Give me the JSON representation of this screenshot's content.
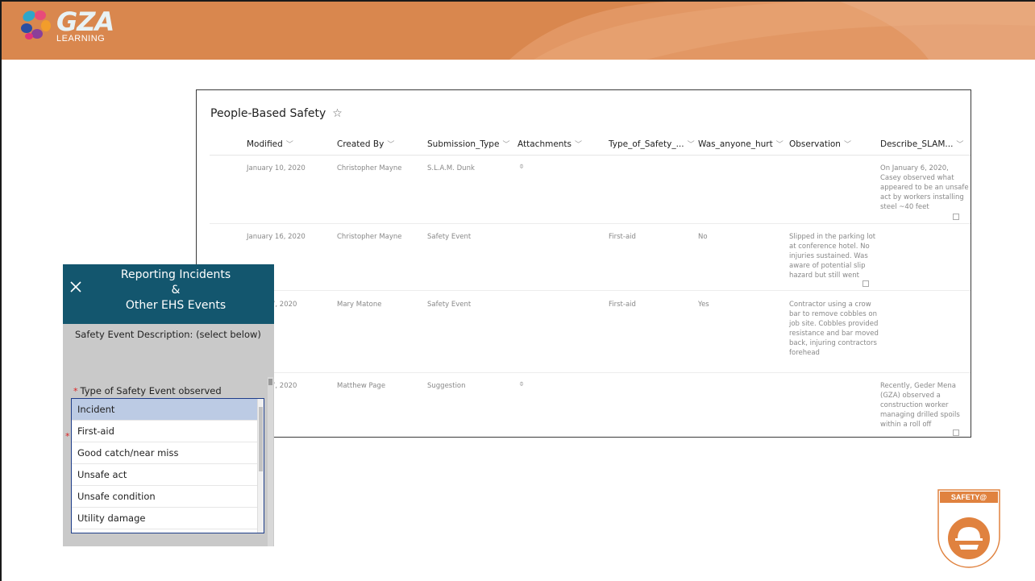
{
  "brand": {
    "name": "GZA",
    "sub": "LEARNING",
    "colors": {
      "banner": "#d9874e",
      "app_header": "#13566e",
      "selected": "#bccbe4"
    }
  },
  "list": {
    "title": "People-Based Safety",
    "columns": [
      "Modified",
      "Created By",
      "Submission_Type",
      "Attachments",
      "Type_of_Safety_...",
      "Was_anyone_hurt",
      "Observation",
      "Describe_SLAM..."
    ],
    "rows": [
      {
        "modified": "January 10, 2020",
        "created_by": "Christopher Mayne",
        "submission_type": "S.L.A.M. Dunk",
        "type_of_safety": "",
        "hurt": "",
        "observation": "",
        "describe": "On January 6, 2020, Casey observed what appeared to be an unsafe act by workers installing steel ~40 feet"
      },
      {
        "modified": "January 16, 2020",
        "created_by": "Christopher Mayne",
        "submission_type": "Safety Event",
        "type_of_safety": "First-aid",
        "hurt": "No",
        "observation": "Slipped in the parking lot at conference hotel. No injuries sustained. Was aware of potential slip hazard but still went",
        "describe": ""
      },
      {
        "modified": "7, 2020",
        "created_by": "Mary Matone",
        "submission_type": "Safety Event",
        "type_of_safety": "First-aid",
        "hurt": "Yes",
        "observation": "Contractor using a crow bar to remove cobbles on job site. Cobbles provided resistance and bar moved back, injuring contractors forehead",
        "describe": ""
      },
      {
        "modified": "7, 2020",
        "created_by": "Matthew Page",
        "submission_type": "Suggestion",
        "type_of_safety": "",
        "hurt": "",
        "observation": "",
        "describe": "Recently, Geder Mena (GZA) observed a construction worker managing drilled spoils within a roll off"
      }
    ]
  },
  "app": {
    "title_line1": "Reporting Incidents",
    "title_line2": "&",
    "title_line3": "Other EHS Events",
    "section_label": "Safety Event Description: (select below)",
    "field_label": "Type of Safety Event observed",
    "required_mark": "*",
    "options": [
      "Incident",
      "First-aid",
      "Good catch/near miss",
      "Unsafe act",
      "Unsafe condition",
      "Utility damage"
    ],
    "selected": "Incident"
  },
  "badge": {
    "label": "SAFETY@"
  }
}
